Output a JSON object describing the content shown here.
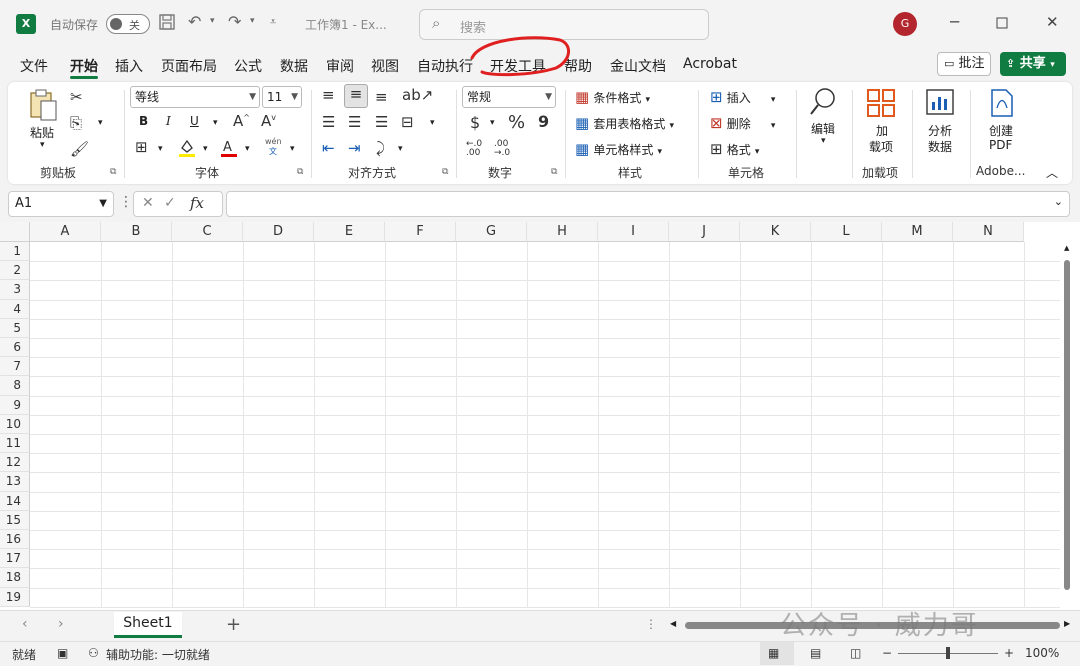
{
  "titlebar": {
    "app_logo": "X",
    "autosave_label": "自动保存",
    "autosave_state": "关",
    "doc_title": "工作簿1  -  Ex...",
    "search_placeholder": "搜索",
    "avatar_initial": "G"
  },
  "menu": {
    "tabs": [
      "文件",
      "开始",
      "插入",
      "页面布局",
      "公式",
      "数据",
      "审阅",
      "视图",
      "自动执行",
      "开发工具",
      "帮助",
      "金山文档",
      "Acrobat"
    ],
    "active_tab": "开始",
    "comment_label": "批注",
    "share_label": "共享"
  },
  "ribbon": {
    "clipboard": {
      "paste_label": "粘贴",
      "group_label": "剪贴板"
    },
    "font": {
      "font_name": "等线",
      "font_size": "11",
      "bold": "B",
      "italic": "I",
      "underline": "U",
      "phonetic": "wén",
      "phonetic_char": "文",
      "group_label": "字体"
    },
    "alignment": {
      "group_label": "对齐方式"
    },
    "number": {
      "format": "常规",
      "currency": "$",
      "percent": "%",
      "comma": "9",
      "group_label": "数字"
    },
    "styles": {
      "conditional": "条件格式",
      "table_format": "套用表格格式",
      "cell_styles": "单元格样式",
      "group_label": "样式"
    },
    "cells": {
      "insert": "插入",
      "delete": "删除",
      "format": "格式",
      "group_label": "单元格"
    },
    "editing": {
      "label": "编辑"
    },
    "addins": {
      "label_line1": "加",
      "label_line2": "载项",
      "group_label": "加载项"
    },
    "analyze": {
      "label_line1": "分析",
      "label_line2": "数据"
    },
    "pdf": {
      "label_line1": "创建",
      "label_line2": "PDF",
      "group_label": "Adobe..."
    }
  },
  "formula_bar": {
    "name_box": "A1",
    "fx": "fx",
    "formula": ""
  },
  "grid": {
    "columns": [
      "A",
      "B",
      "C",
      "D",
      "E",
      "F",
      "G",
      "H",
      "I",
      "J",
      "K",
      "L",
      "M",
      "N"
    ],
    "rows": [
      "1",
      "2",
      "3",
      "4",
      "5",
      "6",
      "7",
      "8",
      "9",
      "10",
      "11",
      "12",
      "13",
      "14",
      "15",
      "16",
      "17",
      "18",
      "19"
    ]
  },
  "sheets": {
    "tabs": [
      "Sheet1"
    ],
    "add_label": "+"
  },
  "status": {
    "ready": "就绪",
    "accessibility": "辅助功能: 一切就绪",
    "zoom": "100%",
    "zoom_level": 1.0
  },
  "watermark": "公众号 · 威力哥",
  "colors": {
    "accent": "#107c41",
    "avatar": "#b3262d",
    "annotation": "#e02020"
  }
}
